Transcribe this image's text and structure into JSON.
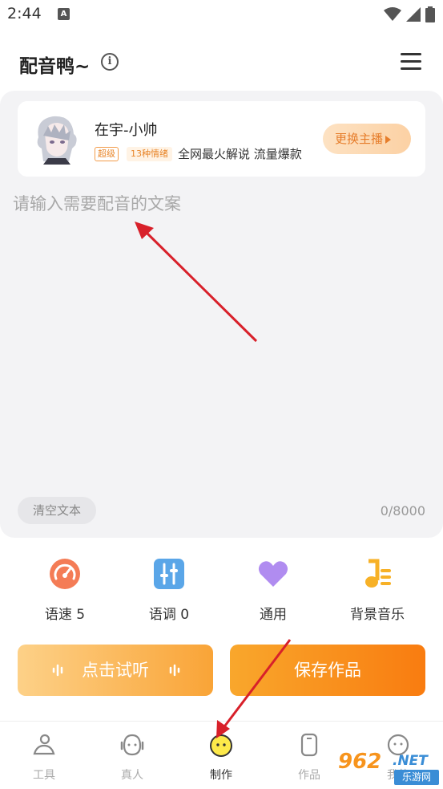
{
  "status_bar": {
    "time": "2:44",
    "notification_glyph": "A"
  },
  "header": {
    "title": "配音鸭~",
    "info_glyph": "i"
  },
  "anchor": {
    "name": "在宇-小帅",
    "badge_level": "超级",
    "badge_emotions": "13种情绪",
    "description": "全网最火解说 流量爆款",
    "switch_label": "更换主播"
  },
  "editor": {
    "placeholder": "请输入需要配音的文案",
    "value": "",
    "clear_label": "清空文本",
    "char_count": "0/8000"
  },
  "tools": [
    {
      "label": "语速 5",
      "icon": "speed-gauge-icon",
      "color": "#f47c56"
    },
    {
      "label": "语调 0",
      "icon": "tone-sliders-icon",
      "color": "#5aa6e8"
    },
    {
      "label": "通用",
      "icon": "heart-icon",
      "color": "#b08cf0"
    },
    {
      "label": "背景音乐",
      "icon": "music-note-icon",
      "color": "#f7b127"
    }
  ],
  "actions": {
    "listen_label": "点击试听",
    "save_label": "保存作品"
  },
  "nav": [
    {
      "label": "工具",
      "icon": "tools-person-icon"
    },
    {
      "label": "真人",
      "icon": "headset-face-icon"
    },
    {
      "label": "制作",
      "icon": "smiley-face-icon",
      "active": true
    },
    {
      "label": "作品",
      "icon": "phone-icon"
    },
    {
      "label": "我的",
      "icon": "chat-face-icon"
    }
  ],
  "watermark": {
    "number": "962",
    "domain": ".NET",
    "site": "乐游网"
  },
  "colors": {
    "accent": "#f97c10",
    "arrow": "#d8202a",
    "editor_bg": "#f3f3f5"
  }
}
